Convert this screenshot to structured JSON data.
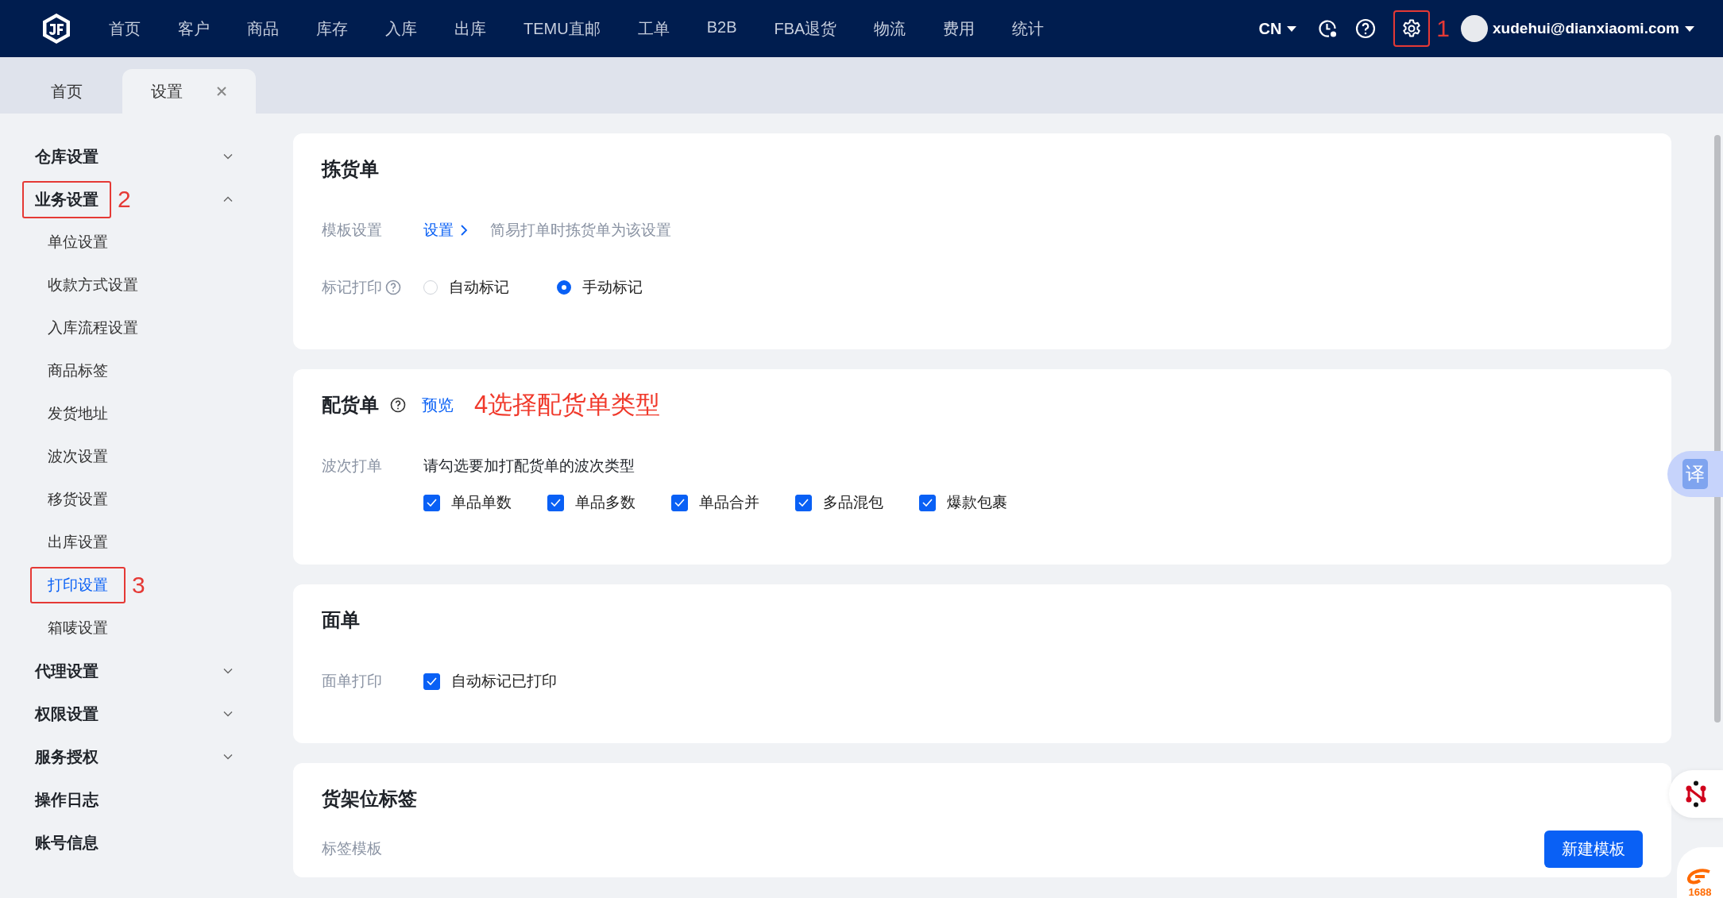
{
  "nav": {
    "menu": [
      "首页",
      "客户",
      "商品",
      "库存",
      "入库",
      "出库",
      "TEMU直邮",
      "工单",
      "B2B",
      "FBA退货",
      "物流",
      "费用",
      "统计"
    ],
    "language": "CN",
    "settings_annotation": "1",
    "user": "xudehui@dianxiaomi.com"
  },
  "tabs": [
    {
      "label": "首页",
      "selected": false,
      "closable": false
    },
    {
      "label": "设置",
      "selected": true,
      "closable": true
    }
  ],
  "sidebar": [
    {
      "label": "仓库设置",
      "kind": "group",
      "expanded": false
    },
    {
      "label": "业务设置",
      "kind": "group",
      "expanded": true,
      "annotation": "2",
      "children": [
        {
          "label": "单位设置",
          "selected": false
        },
        {
          "label": "收款方式设置",
          "selected": false
        },
        {
          "label": "入库流程设置",
          "selected": false
        },
        {
          "label": "商品标签",
          "selected": false
        },
        {
          "label": "发货地址",
          "selected": false
        },
        {
          "label": "波次设置",
          "selected": false
        },
        {
          "label": "移货设置",
          "selected": false
        },
        {
          "label": "出库设置",
          "selected": false
        },
        {
          "label": "打印设置",
          "selected": true,
          "annotation": "3"
        },
        {
          "label": "箱唛设置",
          "selected": false
        }
      ]
    },
    {
      "label": "代理设置",
      "kind": "group",
      "expanded": false
    },
    {
      "label": "权限设置",
      "kind": "group",
      "expanded": false
    },
    {
      "label": "服务授权",
      "kind": "group",
      "expanded": false
    },
    {
      "label": "操作日志",
      "kind": "link"
    },
    {
      "label": "账号信息",
      "kind": "link"
    }
  ],
  "cards": [
    {
      "title": "拣货单",
      "rows": [
        {
          "label": "模板设置",
          "kind": "link",
          "link": "设置",
          "hint": "简易打单时拣货单为该设置"
        },
        {
          "label": "标记打印",
          "help": true,
          "kind": "radio",
          "options": [
            {
              "label": "自动标记",
              "selected": false
            },
            {
              "label": "手动标记",
              "selected": true
            }
          ]
        }
      ]
    },
    {
      "title": "配货单",
      "help": true,
      "link": "预览",
      "annotation": "4选择配货单类型",
      "rows": [
        {
          "label": "波次打单",
          "kind": "checkboxes",
          "text": "请勾选要加打配货单的波次类型",
          "options": [
            {
              "label": "单品单数",
              "checked": true
            },
            {
              "label": "单品多数",
              "checked": true
            },
            {
              "label": "单品合并",
              "checked": true
            },
            {
              "label": "多品混包",
              "checked": true
            },
            {
              "label": "爆款包裹",
              "checked": true
            }
          ]
        }
      ]
    },
    {
      "title": "面单",
      "rows": [
        {
          "label": "面单打印",
          "kind": "checkboxes",
          "options": [
            {
              "label": "自动标记已打印",
              "checked": true
            }
          ]
        }
      ]
    },
    {
      "title": "货架位标签",
      "rows": [
        {
          "label": "标签模板",
          "kind": "button",
          "button": "新建模板"
        }
      ]
    }
  ],
  "floating": {
    "translate": "译",
    "badge": "1688"
  }
}
